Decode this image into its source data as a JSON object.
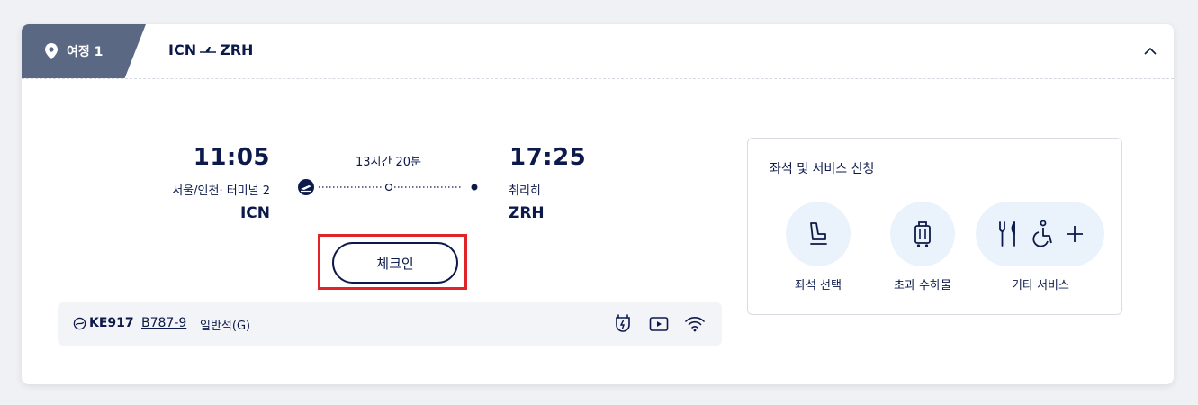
{
  "header": {
    "journey_label": "여정 1",
    "route_origin": "ICN",
    "route_destination": "ZRH"
  },
  "flight": {
    "departure": {
      "time": "11:05",
      "place": "서울/인천· 터미널  2",
      "code": "ICN"
    },
    "arrival": {
      "time": "17:25",
      "place": "취리히",
      "code": "ZRH"
    },
    "duration": "13시간 20분",
    "checkin_label": "체크인"
  },
  "flight_info": {
    "flight_number": "KE917",
    "aircraft": "B787-9",
    "cabin_class": "일반석(G)",
    "amenity_icons": [
      "power-outlet-icon",
      "video-icon",
      "wifi-icon"
    ]
  },
  "services": {
    "title": "좌석 및 서비스 신청",
    "items": [
      {
        "label": "좌석 선택",
        "icon": "seat-icon"
      },
      {
        "label": "초과 수하물",
        "icon": "luggage-icon"
      },
      {
        "label": "기타 서비스",
        "icons": [
          "meal-icon",
          "wheelchair-icon",
          "plus-icon"
        ]
      }
    ]
  },
  "colors": {
    "navy": "#0c1a4b",
    "tab_gray": "#5b6884",
    "service_circle": "#eaf3fb",
    "highlight_red": "#e0252a",
    "info_bar": "#f3f4f7"
  }
}
